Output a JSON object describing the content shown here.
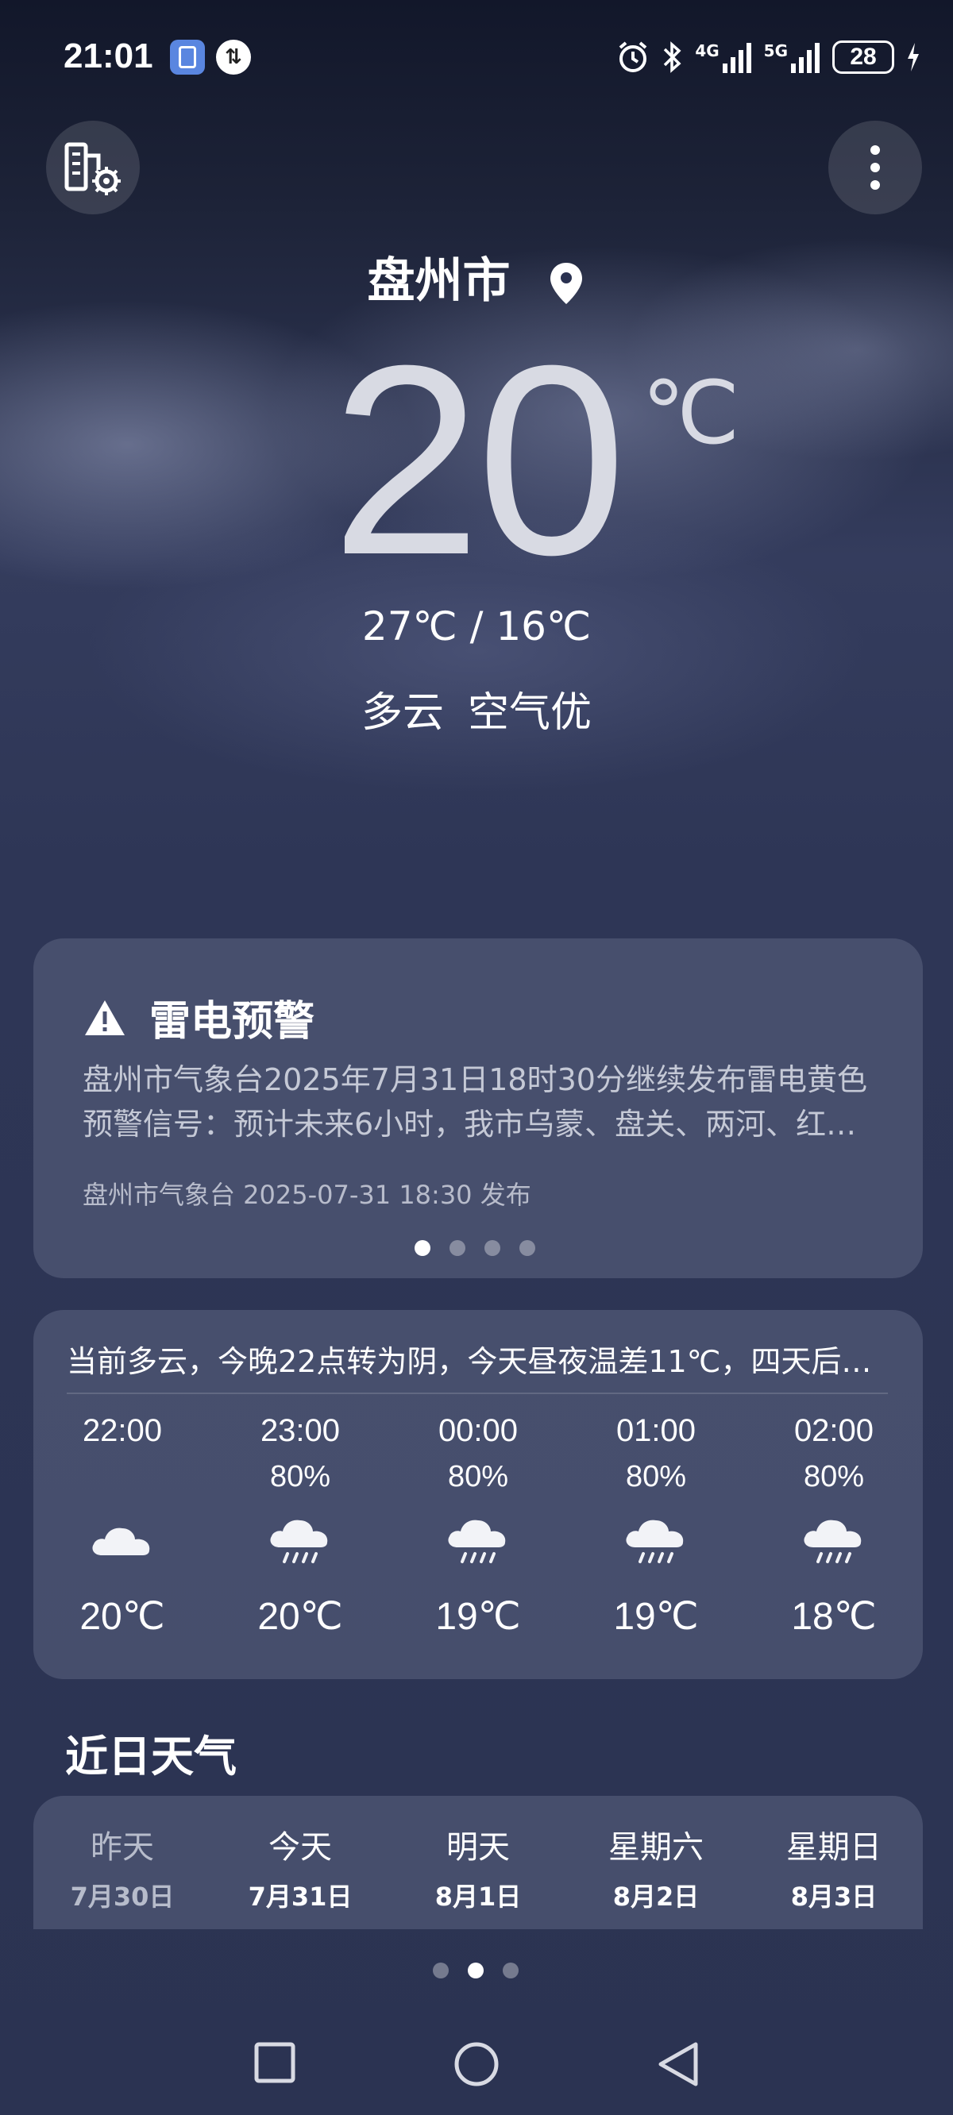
{
  "status_bar": {
    "time": "21:01",
    "network_1": "4G",
    "network_2": "5G",
    "battery": "28"
  },
  "header": {
    "city": "盘州市",
    "temperature": "20",
    "unit": "℃",
    "high_low": "27℃ / 16℃",
    "condition": "多云",
    "air_quality": "空气优"
  },
  "alert": {
    "title": "雷电预警",
    "body": "盘州市气象台2025年7月31日18时30分继续发布雷电黄色预警信号：预计未来6小时，我市乌蒙、盘关、两河、红…",
    "source": "盘州市气象台 2025-07-31 18:30 发布",
    "page_count": 4,
    "active_page": 1
  },
  "hourly": {
    "summary": "当前多云，今晚22点转为阴，今天昼夜温差11℃，四天后…",
    "items": [
      {
        "time": "22:00",
        "precip": "",
        "icon": "cloud-icon",
        "temp": "20℃"
      },
      {
        "time": "23:00",
        "precip": "80%",
        "icon": "rain-cloud-icon",
        "temp": "20℃"
      },
      {
        "time": "00:00",
        "precip": "80%",
        "icon": "rain-cloud-icon",
        "temp": "19℃"
      },
      {
        "time": "01:00",
        "precip": "80%",
        "icon": "rain-cloud-icon",
        "temp": "19℃"
      },
      {
        "time": "02:00",
        "precip": "80%",
        "icon": "rain-cloud-icon",
        "temp": "18℃"
      }
    ]
  },
  "daily": {
    "title": "近日天气",
    "items": [
      {
        "name": "昨天",
        "date": "7月30日",
        "icon": "cloud-icon"
      },
      {
        "name": "今天",
        "date": "7月31日",
        "icon": "sun-icon"
      },
      {
        "name": "明天",
        "date": "8月1日",
        "icon": "sun-icon"
      },
      {
        "name": "星期六",
        "date": "8月2日",
        "icon": "sun-icon"
      },
      {
        "name": "星期日",
        "date": "8月3日",
        "icon": "sun-icon"
      }
    ]
  },
  "pager": {
    "count": 3,
    "active": 2
  },
  "colors": {
    "accent_sun": "#f5c03c",
    "card_bg": "#5c6482"
  }
}
